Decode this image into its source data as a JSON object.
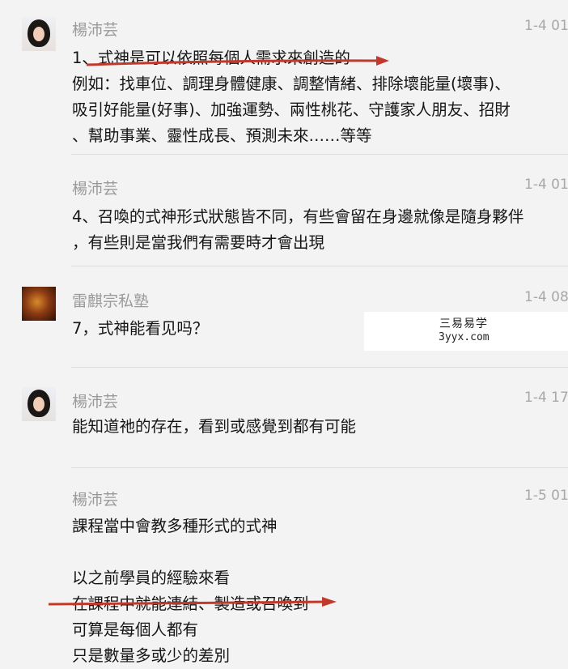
{
  "messages": [
    {
      "sender": "楊沛芸",
      "time": "1-4 01:",
      "lines": [
        "1、式神是可以依照每個人需求來創造的",
        "例如：找車位、調理身體健康、調整情緒、排除壞能量(壞事)、",
        "吸引好能量(好事)、加強運勢、兩性桃花、守護家人朋友、招財",
        "、幫助事業、靈性成長、預測未來……等等"
      ]
    },
    {
      "sender": "楊沛芸",
      "time": "1-4 01:",
      "lines": [
        "4、召喚的式神形式狀態皆不同，有些會留在身邊就像是隨身夥伴",
        "，有些則是當我們有需要時才會出現"
      ]
    },
    {
      "sender": "雷麒宗私塾",
      "time": "1-4 08:",
      "lines": [
        "7，式神能看见吗？"
      ]
    },
    {
      "sender": "楊沛芸",
      "time": "1-4 17:",
      "lines": [
        "能知道祂的存在，看到或感覺到都有可能"
      ]
    },
    {
      "sender": "楊沛芸",
      "time": "1-5 01:",
      "lines": [
        "課程當中會教多種形式的式神",
        "",
        "以之前學員的經驗來看",
        "在課程中就能連結、製造或召喚到",
        "可算是每個人都有",
        "只是數量多或少的差別"
      ]
    }
  ],
  "watermark": {
    "line1": "三易易学",
    "line2": "3yyx.com"
  },
  "colors": {
    "background": "#f3f3f3",
    "annotation_arrow": "#c0392b",
    "sender_name": "#9a9a9a"
  }
}
